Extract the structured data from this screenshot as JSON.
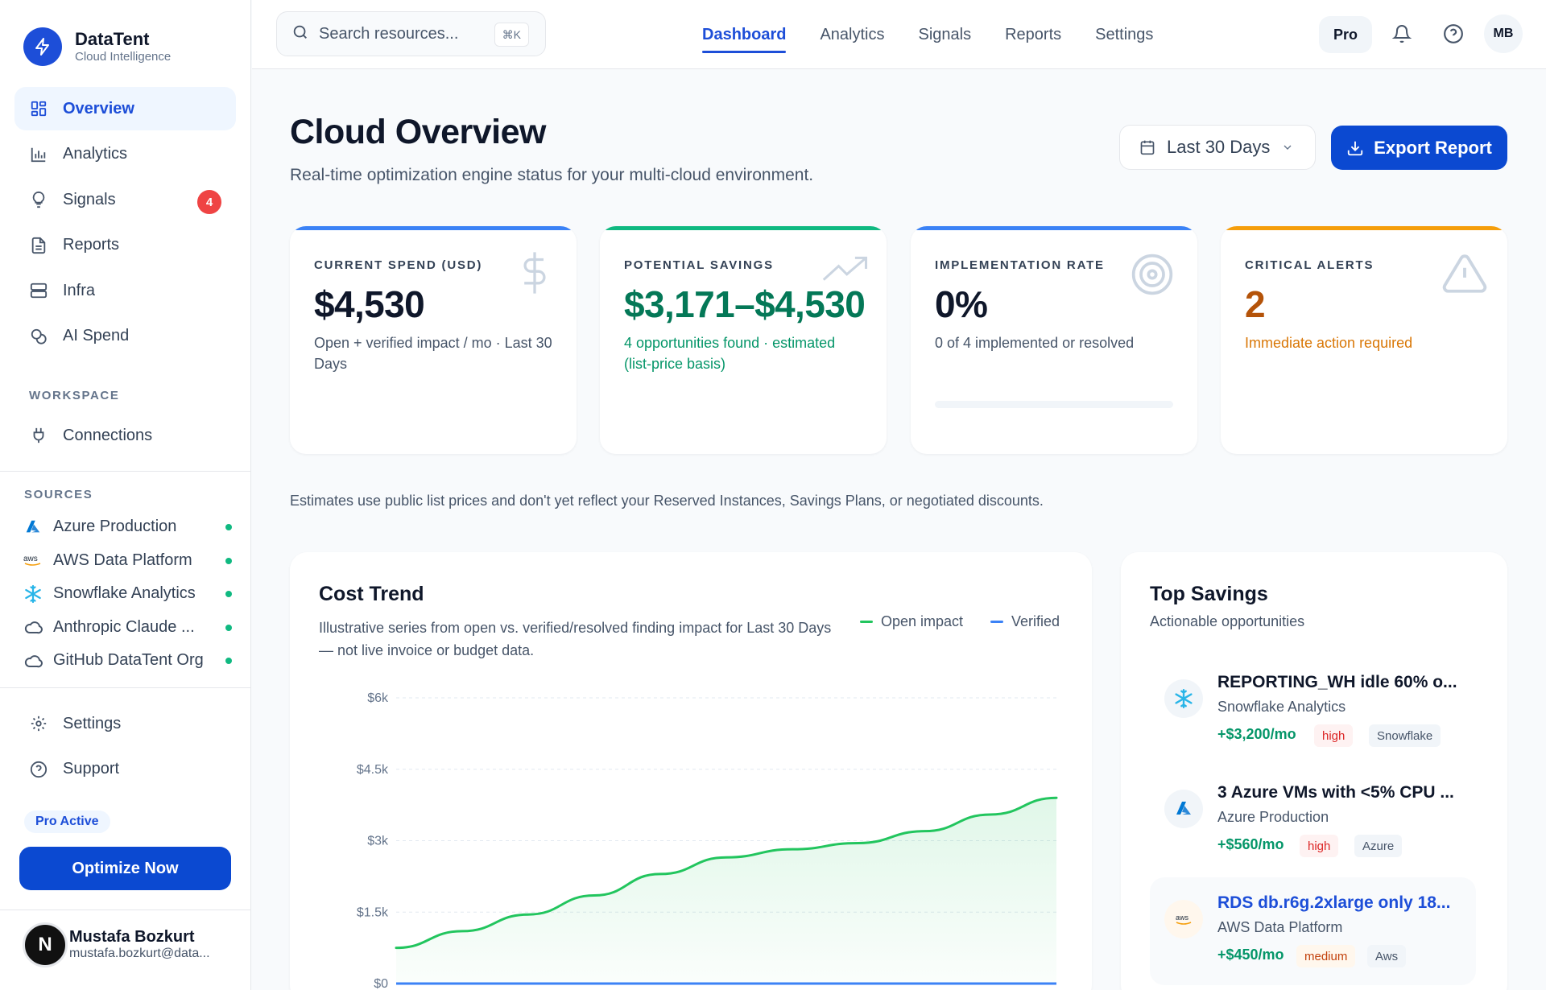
{
  "brand": {
    "name": "DataTent",
    "tagline": "Cloud Intelligence"
  },
  "nav": {
    "items": [
      {
        "label": "Overview",
        "icon": "grid-icon",
        "active": true
      },
      {
        "label": "Analytics",
        "icon": "bar-chart-icon"
      },
      {
        "label": "Signals",
        "icon": "lightbulb-icon",
        "badge": "4"
      },
      {
        "label": "Reports",
        "icon": "document-icon"
      },
      {
        "label": "Infra",
        "icon": "server-icon"
      },
      {
        "label": "AI Spend",
        "icon": "coins-icon"
      }
    ],
    "workspace_label": "WORKSPACE",
    "workspace_items": [
      {
        "label": "Connections",
        "icon": "plug-icon"
      }
    ],
    "sources_label": "SOURCES",
    "sources": [
      {
        "label": "Azure Production",
        "icon": "azure-icon",
        "status_color": "#10b981"
      },
      {
        "label": "AWS Data Platform",
        "icon": "aws-icon",
        "status_color": "#10b981"
      },
      {
        "label": "Snowflake Analytics",
        "icon": "snowflake-icon",
        "status_color": "#10b981"
      },
      {
        "label": "Anthropic Claude ...",
        "icon": "cloud-icon",
        "status_color": "#10b981"
      },
      {
        "label": "GitHub DataTent Org",
        "icon": "cloud-icon",
        "status_color": "#10b981"
      }
    ],
    "bottom_items": [
      {
        "label": "Settings",
        "icon": "gear-icon"
      },
      {
        "label": "Support",
        "icon": "help-icon"
      }
    ],
    "pro_badge": "Pro Active",
    "optimize_label": "Optimize Now"
  },
  "user": {
    "initial": "N",
    "name": "Mustafa Bozkurt",
    "email": "mustafa.bozkurt@data..."
  },
  "topbar": {
    "search_placeholder": "Search resources...",
    "search_shortcut": "⌘K",
    "tabs": [
      "Dashboard",
      "Analytics",
      "Signals",
      "Reports",
      "Settings"
    ],
    "active_tab": "Dashboard",
    "plan": "Pro",
    "avatar_initials": "MB"
  },
  "header": {
    "title": "Cloud Overview",
    "subtitle": "Real-time optimization engine status for your multi-cloud environment.",
    "date_range": "Last 30 Days",
    "export_label": "Export Report"
  },
  "kpis": [
    {
      "label": "CURRENT SPEND (USD)",
      "value": "$4,530",
      "desc": "Open + verified impact / mo · Last 30 Days",
      "icon": "dollar-icon",
      "accent": "#3b82f6"
    },
    {
      "label": "POTENTIAL SAVINGS",
      "value": "$3,171–$4,530",
      "desc": "4 opportunities found · estimated (list-price basis)",
      "icon": "trending-up-icon",
      "accent": "#10b981"
    },
    {
      "label": "IMPLEMENTATION RATE",
      "value": "0%",
      "desc": "0 of 4 implemented or resolved",
      "icon": "target-icon",
      "accent": "#3b82f6",
      "progress": 0
    },
    {
      "label": "CRITICAL ALERTS",
      "value": "2",
      "desc": "Immediate action required",
      "icon": "warning-icon",
      "accent": "#f59e0b"
    }
  ],
  "disclaimer": "Estimates use public list prices and don't yet reflect your Reserved Instances, Savings Plans, or negotiated discounts.",
  "cost_trend": {
    "title": "Cost Trend",
    "subtitle": "Illustrative series from open vs. verified/resolved finding impact for Last 30 Days — not live invoice or budget data.",
    "legend": [
      "Open impact",
      "Verified"
    ]
  },
  "chart_data": {
    "type": "line",
    "y_ticks": [
      "$0",
      "$1.5k",
      "$3k",
      "$4.5k",
      "$6k"
    ],
    "ylim": [
      0,
      6000
    ],
    "x": [
      1,
      2,
      3,
      4,
      5,
      6,
      7,
      8,
      9,
      10,
      11
    ],
    "series": [
      {
        "name": "Open impact",
        "color": "#22c55e",
        "values": [
          750,
          1100,
          1450,
          1850,
          2300,
          2650,
          2820,
          2950,
          3200,
          3550,
          3900
        ]
      },
      {
        "name": "Verified",
        "color": "#3b82f6",
        "values": [
          0,
          0,
          0,
          0,
          0,
          0,
          0,
          0,
          0,
          0,
          0
        ]
      }
    ],
    "grid": true,
    "legend_position": "top-right"
  },
  "top_savings": {
    "title": "Top Savings",
    "subtitle": "Actionable opportunities",
    "items": [
      {
        "title": "REPORTING_WH idle 60% o...",
        "source": "Snowflake Analytics",
        "amount": "+$3,200/mo",
        "severity": "high",
        "provider": "Snowflake",
        "icon": "snowflake-icon"
      },
      {
        "title": "3 Azure VMs with <5% CPU ...",
        "source": "Azure Production",
        "amount": "+$560/mo",
        "severity": "high",
        "provider": "Azure",
        "icon": "azure-icon"
      },
      {
        "title": "RDS db.r6g.2xlarge only 18...",
        "source": "AWS Data Platform",
        "amount": "+$450/mo",
        "severity": "medium",
        "provider": "Aws",
        "icon": "aws-icon"
      }
    ]
  }
}
